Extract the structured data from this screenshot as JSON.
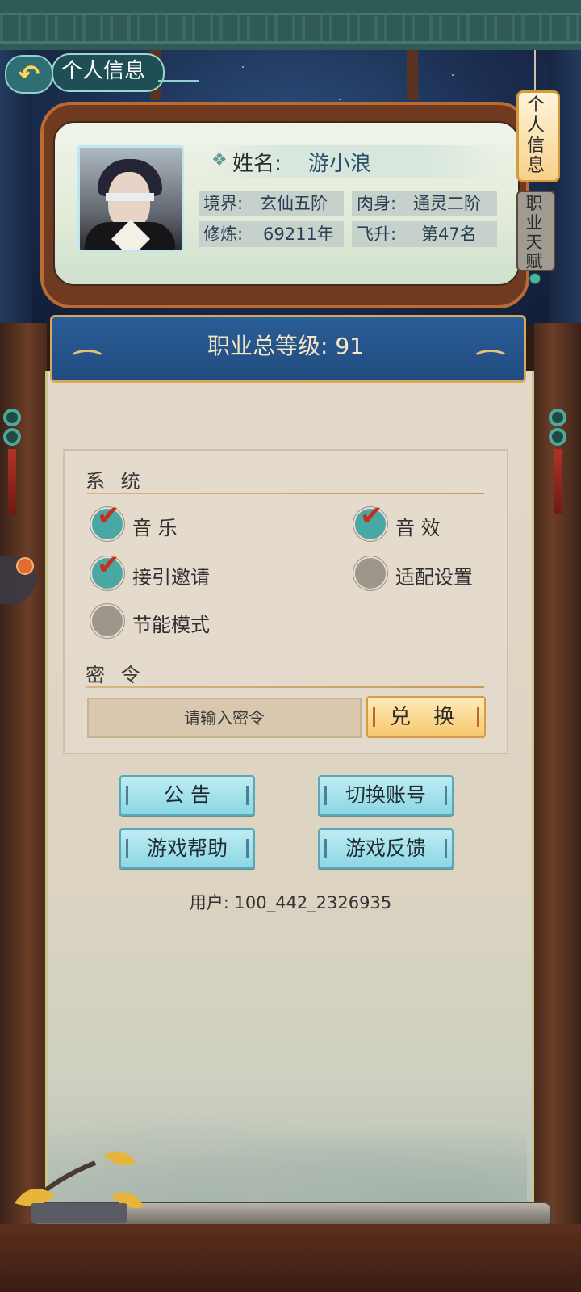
{
  "header": {
    "title": "个人信息",
    "back_icon": "back-arrow-icon"
  },
  "profile": {
    "name_label": "姓名:",
    "name_value": "游小浪",
    "stats": [
      {
        "label": "境界:",
        "value": "玄仙五阶"
      },
      {
        "label": "肉身:",
        "value": "通灵二阶"
      },
      {
        "label": "修炼:",
        "value": "69211年"
      },
      {
        "label": "飞升:",
        "value": "第47名"
      }
    ]
  },
  "side_tabs": {
    "active": "个人信息",
    "inactive": "职业天赋"
  },
  "banner": {
    "text": "职业总等级: 91"
  },
  "settings": {
    "system_title": "系 统",
    "options": [
      {
        "label": "音 乐",
        "checked": true
      },
      {
        "label": "音 效",
        "checked": true
      },
      {
        "label": "接引邀请",
        "checked": true
      },
      {
        "label": "适配设置",
        "checked": false
      },
      {
        "label": "节能模式",
        "checked": false
      }
    ],
    "code_title": "密 令",
    "code_placeholder": "请输入密令",
    "redeem_label": "兑 换"
  },
  "actions": {
    "notice": "公 告",
    "switch_account": "切换账号",
    "help": "游戏帮助",
    "feedback": "游戏反馈"
  },
  "user": {
    "id_text": "用户: 100_442_2326935"
  },
  "colors": {
    "banner_blue": "#2a5d96",
    "check_teal": "#4aa8a4",
    "check_off": "#9d968a",
    "redeem_gold": "#f7c96d",
    "button_cyan": "#8bd7e4"
  }
}
